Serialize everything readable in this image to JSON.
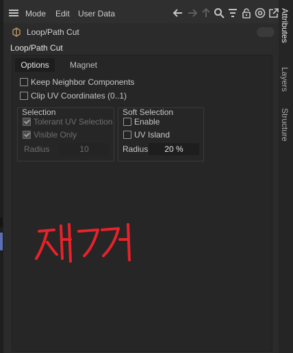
{
  "toolbar": {
    "menu": [
      "Mode",
      "Edit",
      "User Data"
    ],
    "icons": [
      "back-arrow-icon",
      "forward-arrow-icon",
      "up-arrow-icon",
      "search-icon",
      "filter-icon",
      "lock-icon",
      "target-icon",
      "new-window-icon"
    ]
  },
  "object": {
    "name": "Loop/Path Cut",
    "icon": "loop-cut-icon"
  },
  "section_title": "Loop/Path Cut",
  "tabs": [
    {
      "label": "Options",
      "active": true
    },
    {
      "label": "Magnet",
      "active": false
    }
  ],
  "options": {
    "keep_neighbor": {
      "label": "Keep Neighbor Components",
      "checked": false
    },
    "clip_uv": {
      "label": "Clip UV Coordinates (0..1)",
      "checked": false
    }
  },
  "selection": {
    "title": "Selection",
    "tolerant_uv": {
      "label": "Tolerant UV Selection",
      "checked": true,
      "enabled": false
    },
    "visible_only": {
      "label": "Visible Only",
      "checked": true,
      "enabled": false
    },
    "radius_label": "Radius",
    "radius_value": "10"
  },
  "soft_selection": {
    "title": "Soft Selection",
    "enable": {
      "label": "Enable",
      "checked": false
    },
    "uv_island": {
      "label": "UV Island",
      "checked": false
    },
    "radius_label": "Radius",
    "radius_value": "20 %"
  },
  "side_tabs": [
    {
      "label": "Attributes",
      "active": true
    },
    {
      "label": "Layers",
      "active": false
    },
    {
      "label": "Structure",
      "active": false
    }
  ],
  "annotation": {
    "text": "제거",
    "color": "#e8222a"
  }
}
